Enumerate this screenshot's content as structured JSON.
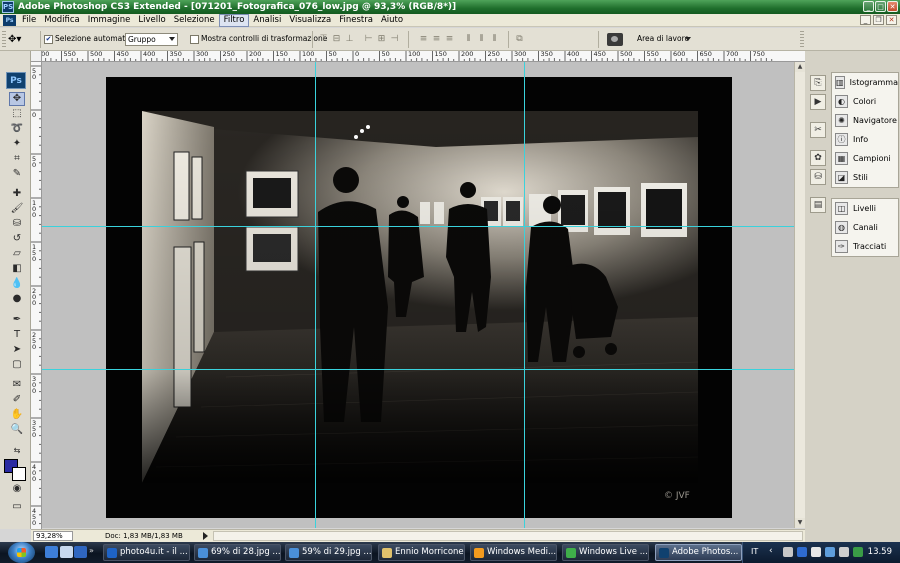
{
  "window": {
    "app_icon": "PS",
    "title": "Adobe Photoshop CS3 Extended - [071201_Fotografica_076_low.jpg @ 93,3% (RGB/8*)]",
    "buttons": [
      "minimize",
      "maximize",
      "close"
    ]
  },
  "menubar": {
    "doc_icon": "Ps",
    "items": [
      "File",
      "Modifica",
      "Immagine",
      "Livello",
      "Selezione",
      "Filtro",
      "Analisi",
      "Visualizza",
      "Finestra",
      "Aiuto"
    ],
    "active_item": "Filtro"
  },
  "options": {
    "auto_select_label": "Selezione automatica:",
    "auto_select_checked": true,
    "auto_select_value": "Gruppo",
    "transform_controls_label": "Mostra controlli di trasformazione",
    "transform_controls_checked": false,
    "workspace_label": "Area di lavoro"
  },
  "toolbox": {
    "logo": "Ps",
    "tools": [
      "move-tool",
      "marquee-tool",
      "lasso-tool",
      "magic-wand-tool",
      "crop-tool",
      "slice-tool",
      "healing-brush-tool",
      "brush-tool",
      "clone-stamp-tool",
      "history-brush-tool",
      "eraser-tool",
      "gradient-tool",
      "blur-tool",
      "dodge-tool",
      "pen-tool",
      "type-tool",
      "path-selection-tool",
      "shape-tool",
      "notes-tool",
      "eyedropper-tool",
      "hand-tool",
      "zoom-tool"
    ],
    "foreground_color": "#2a2aa2",
    "background_color": "#ffffff"
  },
  "rulers": {
    "top": [
      "600",
      "550",
      "500",
      "450",
      "400",
      "350",
      "300",
      "250",
      "200",
      "150",
      "100",
      "50",
      "0",
      "50",
      "100",
      "150",
      "200",
      "250",
      "300",
      "350",
      "400",
      "450",
      "500",
      "550",
      "600",
      "650",
      "700",
      "750"
    ],
    "left": [
      "50",
      "0",
      "50",
      "100",
      "150",
      "200",
      "250",
      "300",
      "350",
      "400",
      "450"
    ]
  },
  "canvas": {
    "image_caption": "© JVF",
    "guide_color": "#3ad2dc"
  },
  "status": {
    "zoom": "93,28%",
    "doc_info": "Doc: 1,83 MB/1,83 MB"
  },
  "panels": {
    "group1": [
      "Istogramma",
      "Colori",
      "Navigatore",
      "Info",
      "Campioni",
      "Stili"
    ],
    "group2": [
      "Livelli",
      "Canali",
      "Tracciati"
    ]
  },
  "taskbar": {
    "tasks": [
      "photo4u.it - il ...",
      "69% di 28.jpg ...",
      "59% di 29.jpg ...",
      "Ennio Morricone",
      "Windows Medi...",
      "Windows Live ...",
      "Adobe Photos..."
    ],
    "active_task": "Adobe Photos...",
    "quicklaunch_more": "»",
    "language": "IT",
    "clock": "13.59"
  }
}
